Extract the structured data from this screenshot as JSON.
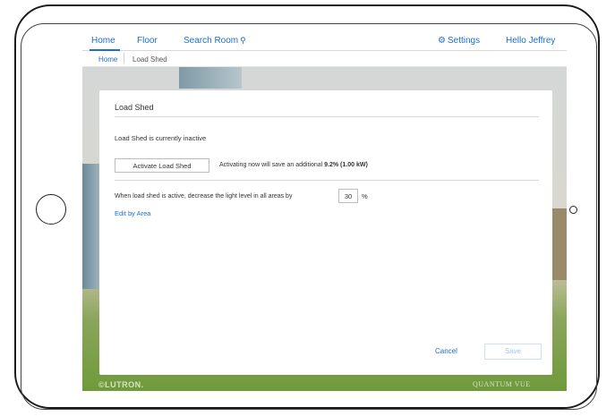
{
  "nav": {
    "home": "Home",
    "floor": "Floor",
    "search_room": "Search Room",
    "settings": "Settings",
    "greeting": "Hello Jeffrey"
  },
  "breadcrumb": {
    "home": "Home",
    "current": "Load Shed"
  },
  "panel": {
    "title": "Load Shed",
    "status": "Load Shed is currently inactive",
    "activate_button": "Activate Load Shed",
    "save_note_prefix": "Activating now will save an additional",
    "save_note_value": "9.2% (1.00 kW)",
    "decrease_label": "When load shed is active, decrease the light level in all areas by",
    "decrease_value": "30",
    "decrease_unit": "%",
    "edit_by_area": "Edit by Area",
    "cancel": "Cancel",
    "save": "Save"
  },
  "footer": {
    "brand_left": "©LUTRON.",
    "brand_right": "QUANTUM VUE"
  },
  "colors": {
    "accent": "#1d6fc9"
  },
  "icons": {
    "search": "search-icon",
    "settings": "gear-icon"
  }
}
